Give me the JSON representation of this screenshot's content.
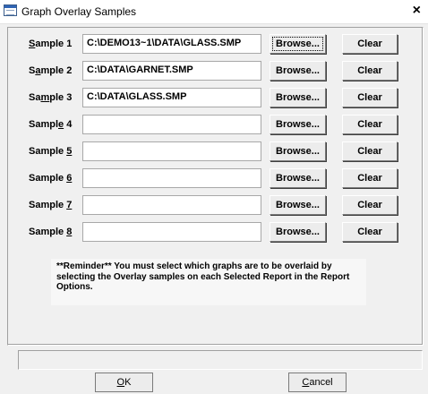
{
  "window": {
    "title": "Graph Overlay Samples",
    "close_glyph": "×"
  },
  "samples": [
    {
      "label_pre": "",
      "label_key": "S",
      "label_post": "ample 1",
      "path": "C:\\DEMO13~1\\DATA\\GLASS.SMP",
      "browse": "Browse...",
      "clear": "Clear"
    },
    {
      "label_pre": "S",
      "label_key": "a",
      "label_post": "mple 2",
      "path": "C:\\DATA\\GARNET.SMP",
      "browse": "Browse...",
      "clear": "Clear"
    },
    {
      "label_pre": "Sa",
      "label_key": "m",
      "label_post": "ple 3",
      "path": "C:\\DATA\\GLASS.SMP",
      "browse": "Browse...",
      "clear": "Clear"
    },
    {
      "label_pre": "Sampl",
      "label_key": "e",
      "label_post": " 4",
      "path": "",
      "browse": "Browse...",
      "clear": "Clear"
    },
    {
      "label_pre": "Sample ",
      "label_key": "5",
      "label_post": "",
      "path": "",
      "browse": "Browse...",
      "clear": "Clear"
    },
    {
      "label_pre": "Sample ",
      "label_key": "6",
      "label_post": "",
      "path": "",
      "browse": "Browse...",
      "clear": "Clear"
    },
    {
      "label_pre": "Sample ",
      "label_key": "7",
      "label_post": "",
      "path": "",
      "browse": "Browse...",
      "clear": "Clear"
    },
    {
      "label_pre": "Sample ",
      "label_key": "8",
      "label_post": "",
      "path": "",
      "browse": "Browse...",
      "clear": "Clear"
    }
  ],
  "reminder": "**Reminder**     You must select which graphs are to be overlaid by selecting the Overlay samples on each Selected Report in the Report Options.",
  "buttons": {
    "ok_key": "O",
    "ok_rest": "K",
    "cancel_key": "C",
    "cancel_rest": "ancel"
  }
}
